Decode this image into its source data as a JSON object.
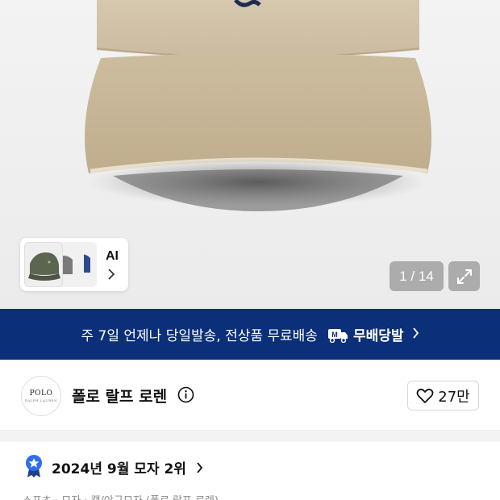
{
  "gallery": {
    "image_counter": "1 / 14",
    "ai_thumbnail_label": "AI",
    "thumbnail_colors": [
      "#5b6650",
      "#7a7a7a",
      "#2e4a8c"
    ],
    "product_color": "#cbbba0"
  },
  "banner": {
    "text": "주 7일 언제나 당일발송, 전상품 무료배송",
    "service_name": "무배당발",
    "background": "#0b2f78"
  },
  "brand": {
    "logo_line1": "POLO",
    "logo_line2": "RALPH LAUREN",
    "name": "폴로 랄프 로렌",
    "like_count": "27만"
  },
  "ranking": {
    "text": "2024년 9월 모자 2위",
    "badge_color": "#2f6df0"
  },
  "breadcrumb": {
    "text": "스포츠 · 모자 · 캡/야구모자 (폴로 랄프 로렌)"
  }
}
